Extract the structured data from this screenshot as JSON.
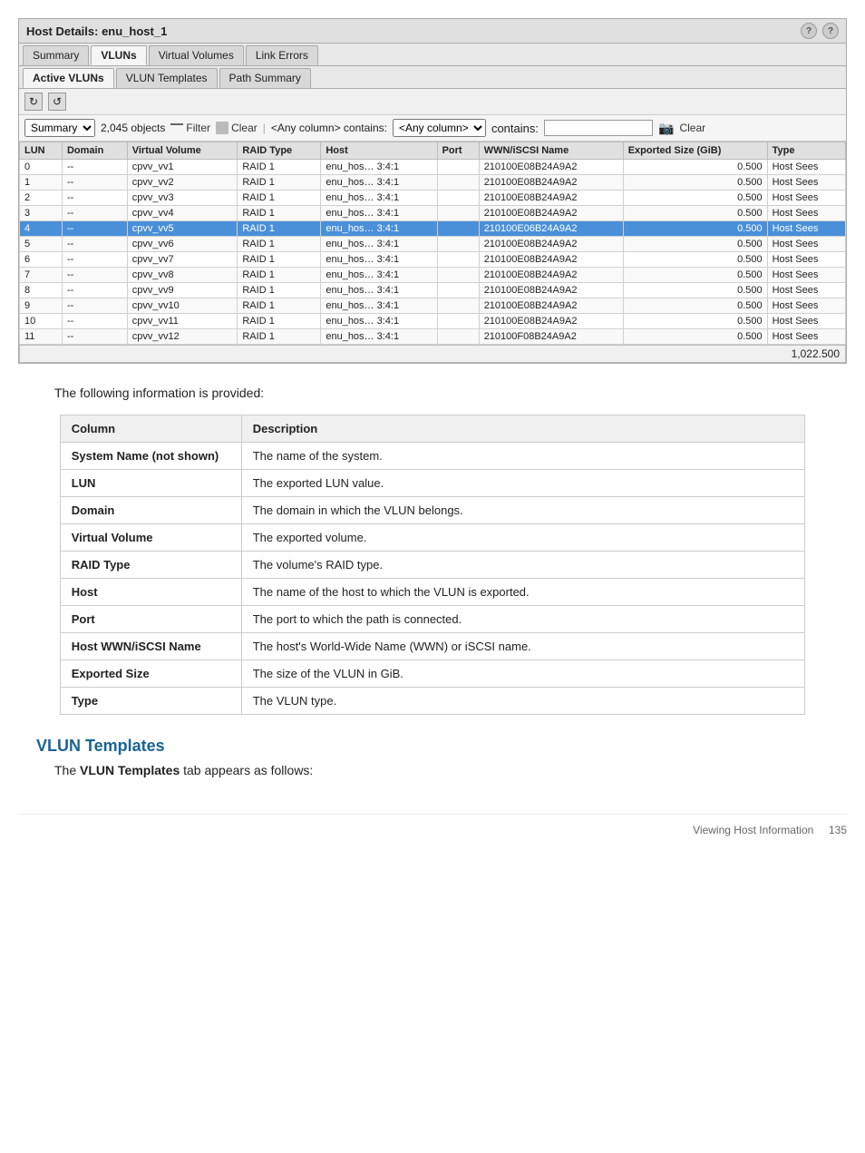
{
  "hostPanel": {
    "title": "Host Details: enu_host_1",
    "icons": [
      "?",
      "?"
    ],
    "tabs1": [
      "Summary",
      "VLUNs",
      "Virtual Volumes",
      "Link Errors"
    ],
    "tabs1Active": "VLUNs",
    "tabs2": [
      "Active VLUNs",
      "VLUN Templates",
      "Path Summary"
    ],
    "tabs2Active": "Active VLUNs",
    "toolbar": {
      "refresh1": "↻",
      "refresh2": "↺"
    },
    "filterBar": {
      "summaryLabel": "Summary",
      "objectCount": "2,045 objects",
      "filterBtn": "Filter",
      "clearBtn": "Clear",
      "columnContains": "<Any column> contains:",
      "inputValue": "",
      "inputPlaceholder": "",
      "clearBtn2": "Clear"
    },
    "tableHeaders": [
      "LUN",
      "Domain",
      "Virtual Volume",
      "RAID Type",
      "Host",
      "Port",
      "WWN/iSCSI Name",
      "Exported Size (GiB)",
      "Type"
    ],
    "tableRows": [
      {
        "lun": "0",
        "domain": "--",
        "vv": "cpvv_vv1",
        "raid": "RAID 1",
        "host": "enu_hos… 3:4:1",
        "port": "",
        "wwn": "210100E08B24A9A2",
        "size": "0.500",
        "type": "Host Sees",
        "selected": false
      },
      {
        "lun": "1",
        "domain": "--",
        "vv": "cpvv_vv2",
        "raid": "RAID 1",
        "host": "enu_hos… 3:4:1",
        "port": "",
        "wwn": "210100E08B24A9A2",
        "size": "0.500",
        "type": "Host Sees",
        "selected": false
      },
      {
        "lun": "2",
        "domain": "--",
        "vv": "cpvv_vv3",
        "raid": "RAID 1",
        "host": "enu_hos… 3:4:1",
        "port": "",
        "wwn": "210100E08B24A9A2",
        "size": "0.500",
        "type": "Host Sees",
        "selected": false
      },
      {
        "lun": "3",
        "domain": "--",
        "vv": "cpvv_vv4",
        "raid": "RAID 1",
        "host": "enu_hos… 3:4:1",
        "port": "",
        "wwn": "210100E08B24A9A2",
        "size": "0.500",
        "type": "Host Sees",
        "selected": false
      },
      {
        "lun": "4",
        "domain": "--",
        "vv": "cpvv_vv5",
        "raid": "RAID 1",
        "host": "enu_hos… 3:4:1",
        "port": "",
        "wwn": "210100E06B24A9A2",
        "size": "0.500",
        "type": "Host Sees",
        "selected": true
      },
      {
        "lun": "5",
        "domain": "--",
        "vv": "cpvv_vv6",
        "raid": "RAID 1",
        "host": "enu_hos… 3:4:1",
        "port": "",
        "wwn": "210100E08B24A9A2",
        "size": "0.500",
        "type": "Host Sees",
        "selected": false
      },
      {
        "lun": "6",
        "domain": "--",
        "vv": "cpvv_vv7",
        "raid": "RAID 1",
        "host": "enu_hos… 3:4:1",
        "port": "",
        "wwn": "210100E08B24A9A2",
        "size": "0.500",
        "type": "Host Sees",
        "selected": false
      },
      {
        "lun": "7",
        "domain": "--",
        "vv": "cpvv_vv8",
        "raid": "RAID 1",
        "host": "enu_hos… 3:4:1",
        "port": "",
        "wwn": "210100E08B24A9A2",
        "size": "0.500",
        "type": "Host Sees",
        "selected": false
      },
      {
        "lun": "8",
        "domain": "--",
        "vv": "cpvv_vv9",
        "raid": "RAID 1",
        "host": "enu_hos… 3:4:1",
        "port": "",
        "wwn": "210100E08B24A9A2",
        "size": "0.500",
        "type": "Host Sees",
        "selected": false
      },
      {
        "lun": "9",
        "domain": "--",
        "vv": "cpvv_vv10",
        "raid": "RAID 1",
        "host": "enu_hos… 3:4:1",
        "port": "",
        "wwn": "210100E08B24A9A2",
        "size": "0.500",
        "type": "Host Sees",
        "selected": false
      },
      {
        "lun": "10",
        "domain": "--",
        "vv": "cpvv_vv11",
        "raid": "RAID 1",
        "host": "enu_hos… 3:4:1",
        "port": "",
        "wwn": "210100E08B24A9A2",
        "size": "0.500",
        "type": "Host Sees",
        "selected": false
      },
      {
        "lun": "11",
        "domain": "--",
        "vv": "cpvv_vv12",
        "raid": "RAID 1",
        "host": "enu_hos… 3:4:1",
        "port": "",
        "wwn": "210100F08B24A9A2",
        "size": "0.500",
        "type": "Host Sees",
        "selected": false
      }
    ],
    "tableFooter": "1,022.500"
  },
  "bodyText": "The following information is provided:",
  "descTable": {
    "headers": [
      "Column",
      "Description"
    ],
    "rows": [
      {
        "column": "System Name (not shown)",
        "description": "The name of the system."
      },
      {
        "column": "LUN",
        "description": "The exported LUN value."
      },
      {
        "column": "Domain",
        "description": "The domain in which the VLUN belongs."
      },
      {
        "column": "Virtual Volume",
        "description": "The exported volume."
      },
      {
        "column": "RAID Type",
        "description": "The volume's RAID type."
      },
      {
        "column": "Host",
        "description": "The name of the host to which the VLUN is exported."
      },
      {
        "column": "Port",
        "description": "The port to which the path is connected."
      },
      {
        "column": "Host WWN/iSCSI Name",
        "description": "The host's World-Wide Name (WWN) or iSCSI name."
      },
      {
        "column": "Exported Size",
        "description": "The size of the VLUN in GiB."
      },
      {
        "column": "Type",
        "description": "The VLUN type."
      }
    ]
  },
  "vlunTemplatesSection": {
    "heading": "VLUN Templates",
    "bodyText": "The",
    "boldText": "VLUN Templates",
    "bodyText2": "tab appears as follows:"
  },
  "pageFooter": {
    "text": "Viewing Host Information",
    "pageNumber": "135"
  }
}
